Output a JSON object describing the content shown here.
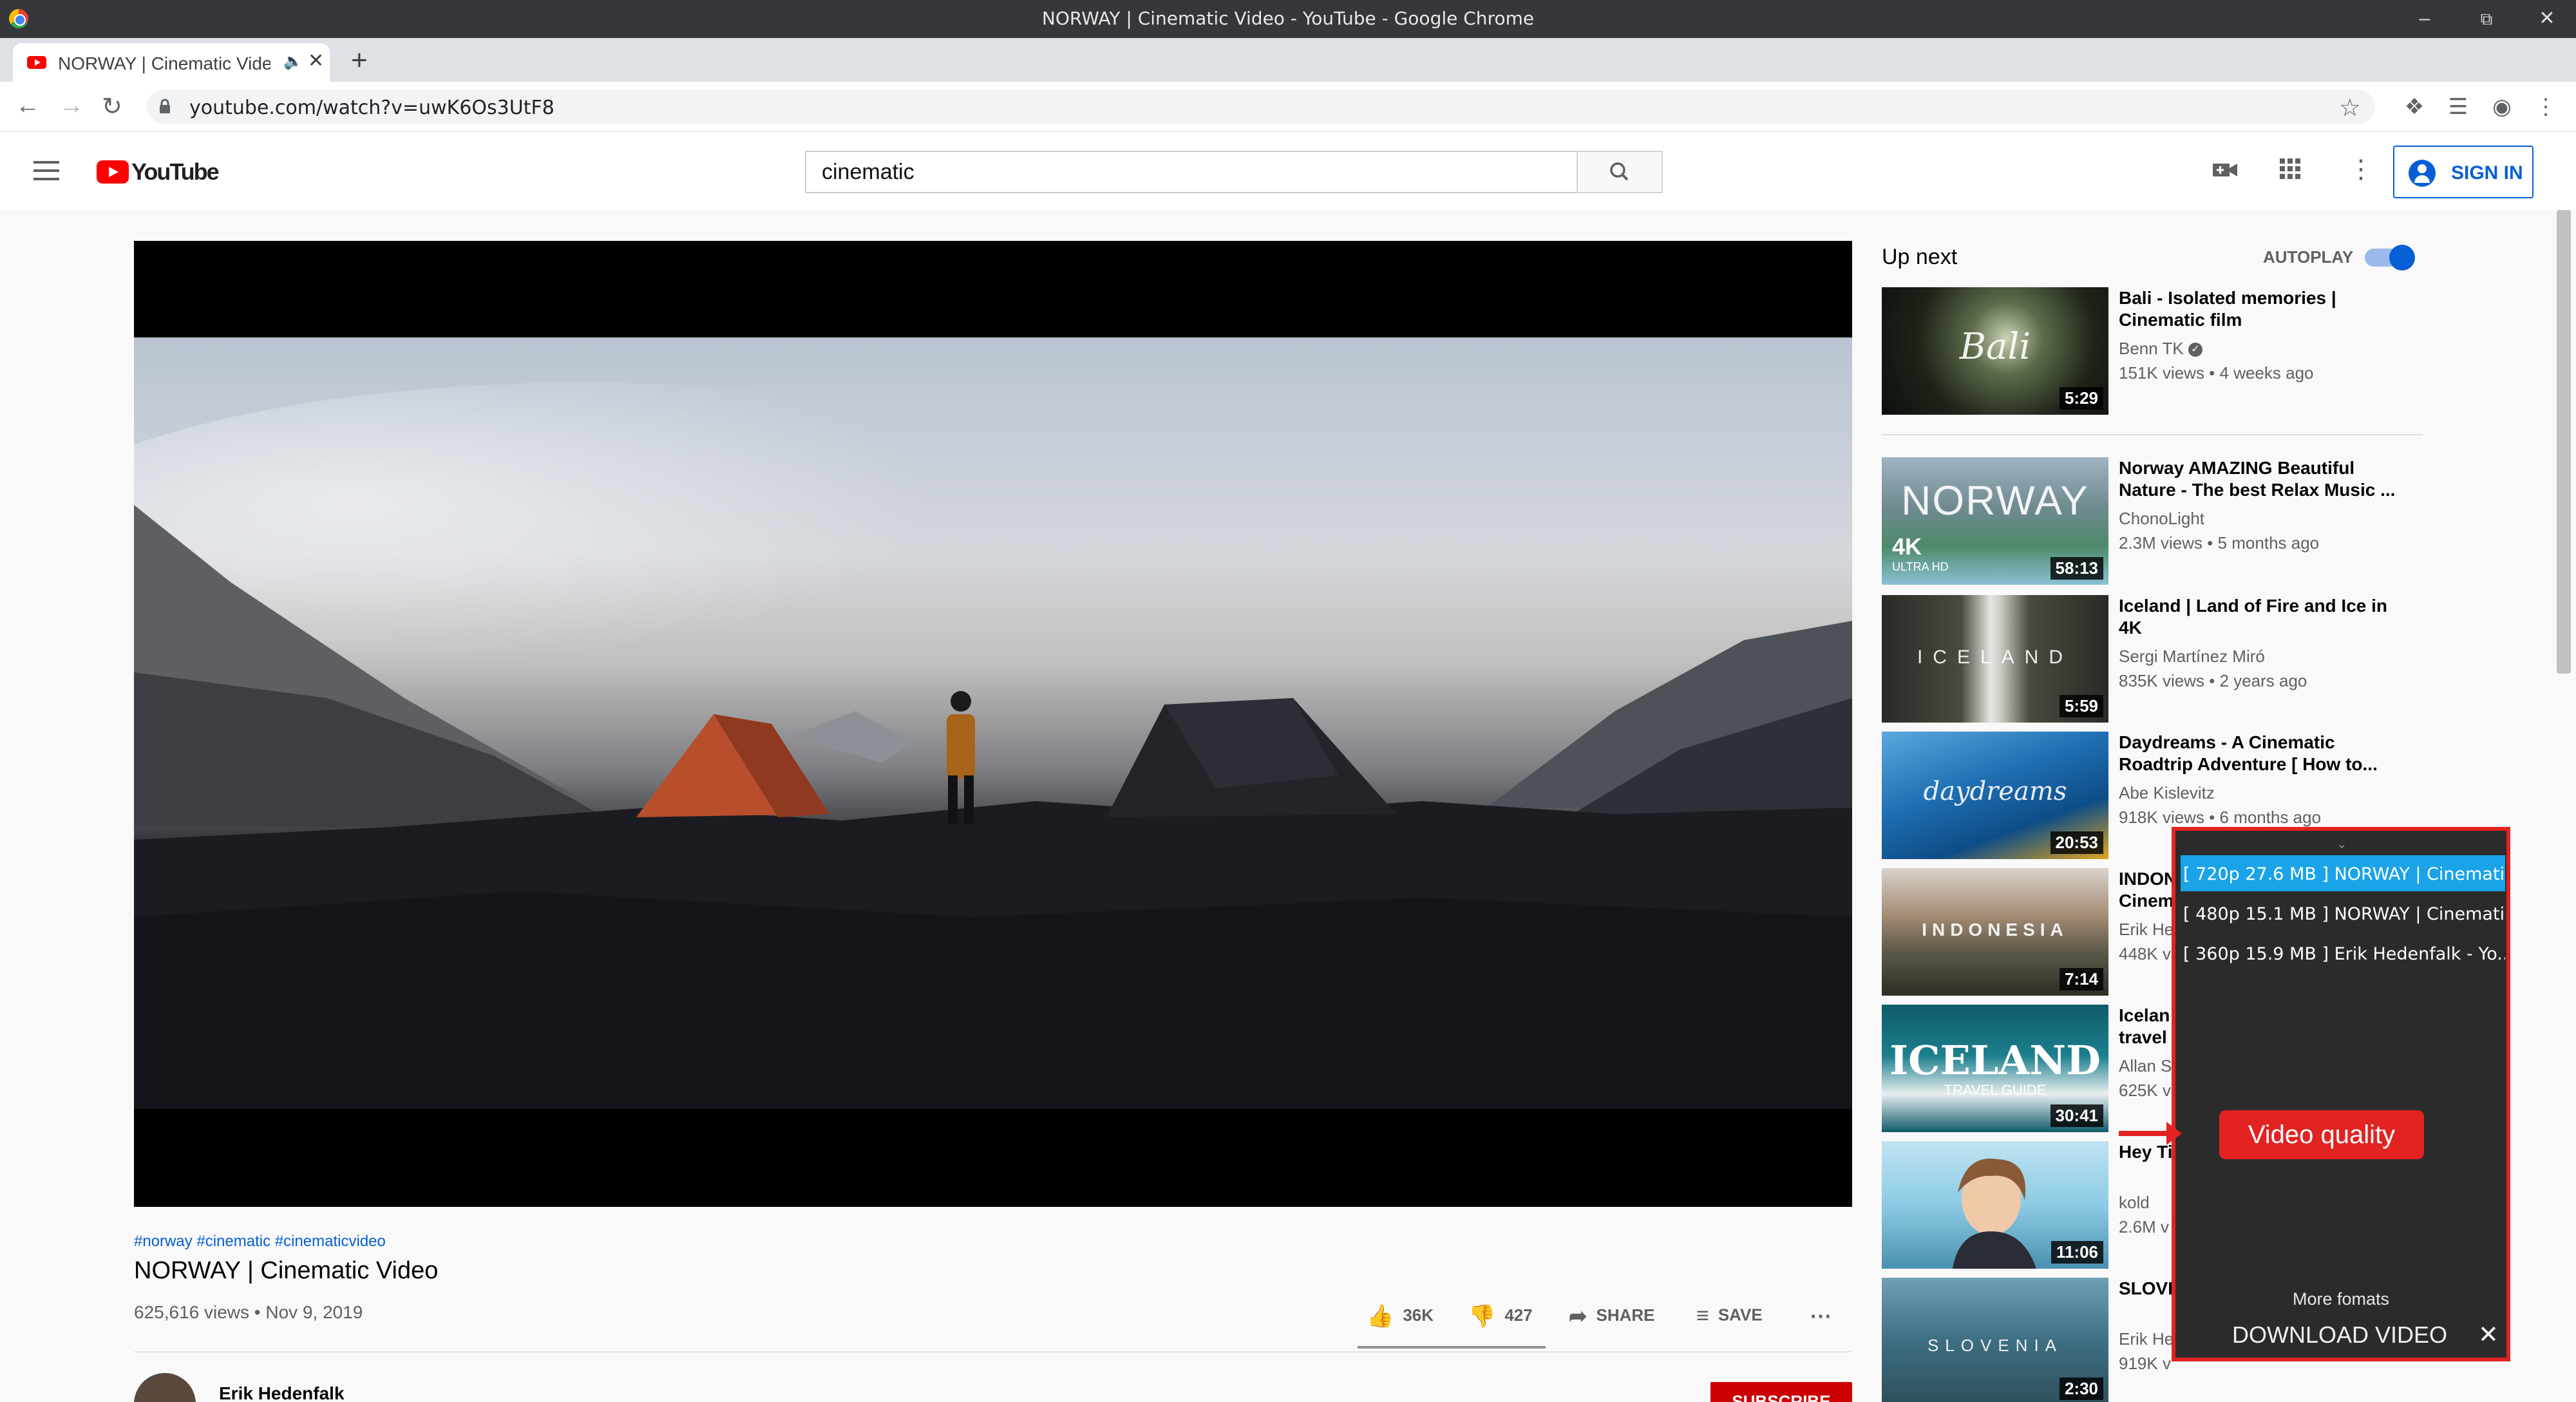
{
  "window": {
    "title": "NORWAY | Cinematic Video - YouTube - Google Chrome"
  },
  "tab": {
    "title": "NORWAY | Cinematic Video - YouTube"
  },
  "address": {
    "url": "youtube.com/watch?v=uwK6Os3UtF8"
  },
  "header": {
    "logo_text": "YouTube",
    "search_value": "cinematic",
    "sign_in_label": "SIGN IN"
  },
  "video": {
    "hashtags": "#norway #cinematic #cinematicvideo",
    "title": "NORWAY | Cinematic Video",
    "stats": "625,616 views • Nov 9, 2019",
    "likes": "36K",
    "dislikes": "427",
    "share_label": "SHARE",
    "save_label": "SAVE",
    "channel": "Erik Hedenfalk",
    "subscribe_label": "SUBSCRIBE"
  },
  "sidebar": {
    "up_next": "Up next",
    "autoplay_label": "AUTOPLAY",
    "items": [
      {
        "title": "Bali - Isolated memories | Cinematic film",
        "channel": "Benn TK",
        "meta": "151K views • 4 weeks ago",
        "duration": "5:29",
        "thumb_text": "Bali"
      },
      {
        "title": "Norway AMAZING Beautiful Nature - The best Relax Music ...",
        "channel": "ChonoLight",
        "meta": "2.3M views • 5 months ago",
        "duration": "58:13",
        "thumb_text": "NORWAY",
        "thumb_sub": "4K",
        "thumb_sub2": "ULTRA HD"
      },
      {
        "title": "Iceland | Land of Fire and Ice in 4K",
        "channel": "Sergi Martínez Miró",
        "meta": "835K views • 2 years ago",
        "duration": "5:59",
        "thumb_text": "ICELAND"
      },
      {
        "title": "Daydreams - A Cinematic Roadtrip Adventure [ How to...",
        "channel": "Abe Kislevitz",
        "meta": "918K views • 6 months ago",
        "duration": "20:53",
        "thumb_text": "daydreams"
      },
      {
        "title": "INDON Cinem",
        "channel": "Erik He",
        "meta": "448K v",
        "duration": "7:14",
        "thumb_text": "INDONESIA"
      },
      {
        "title": "Icelan travel",
        "channel": "Allan S",
        "meta": "625K v",
        "duration": "30:41",
        "thumb_text": "ICELAND",
        "thumb_sub": "TRAVEL GUIDE"
      },
      {
        "title": "Hey Ti",
        "channel": "kold",
        "meta": "2.6M v",
        "duration": "11:06",
        "thumb_text": ""
      },
      {
        "title": "SLOVE",
        "channel": "Erik He",
        "meta": "919K v",
        "duration": "2:30",
        "thumb_text": "SLOVENIA"
      }
    ]
  },
  "download": {
    "options": [
      "[ 720p 27.6 MB ]  NORWAY | Cinemati...",
      "[ 480p 15.1 MB ]  NORWAY | Cinemati...",
      "[ 360p 15.9 MB ]  Erik Hedenfalk - Yo..."
    ],
    "more_label": "More fomats",
    "button_label": "DOWNLOAD VIDEO",
    "callout_label": "Video quality"
  },
  "colors": {
    "accent": "#065fd4",
    "youtube_red": "#ff0000",
    "highlight": "#e32222",
    "selected_option": "#1aa3e8"
  }
}
